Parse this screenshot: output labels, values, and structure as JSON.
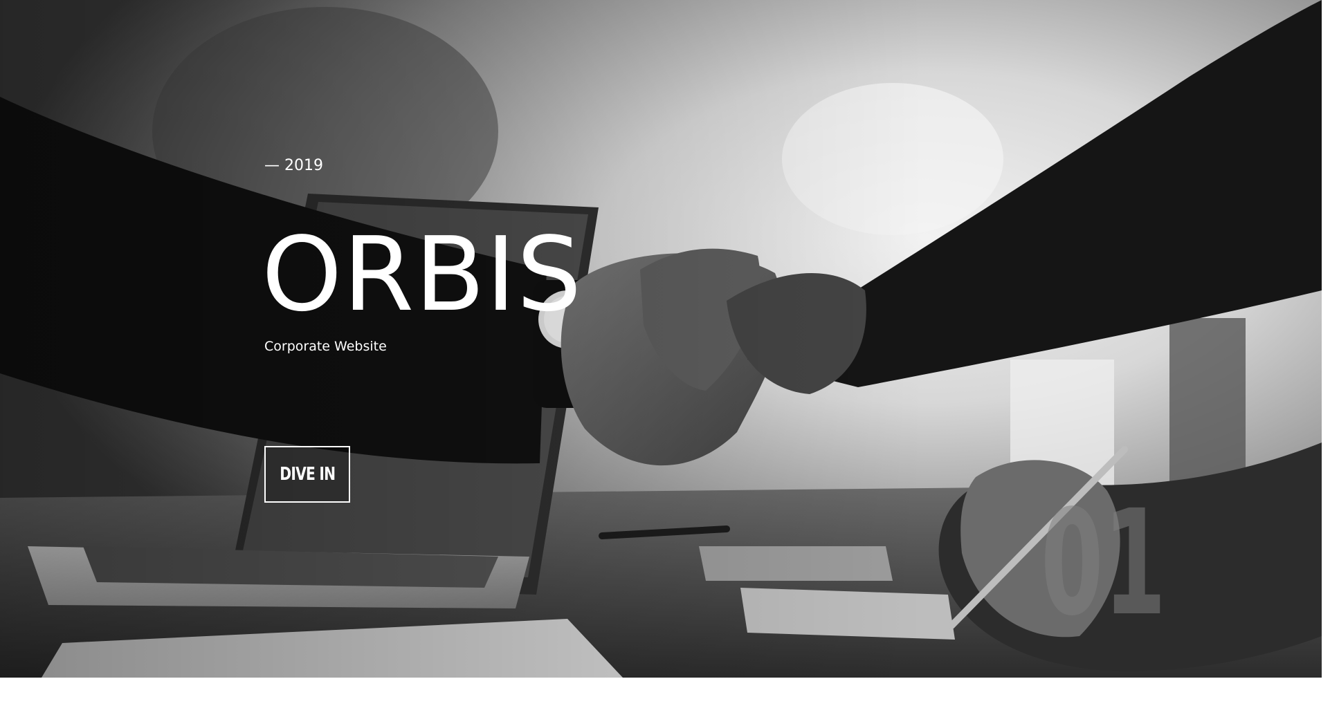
{
  "hero": {
    "year": "— 2019",
    "title": "ORBIS",
    "subtitle": "Corporate Website",
    "cta_label": "DIVE IN",
    "slide_number": "01"
  },
  "colors": {
    "text": "#ffffff",
    "page_background": "#ffffff",
    "photo_tone": "grayscale"
  }
}
